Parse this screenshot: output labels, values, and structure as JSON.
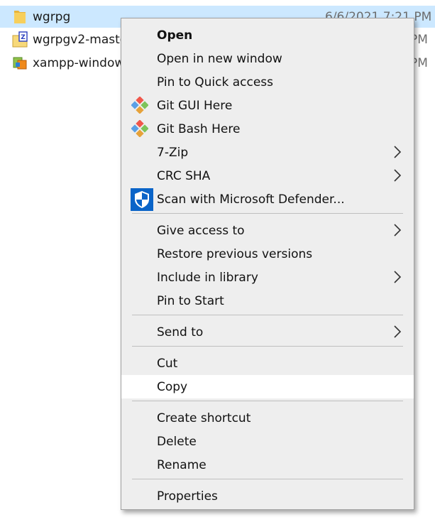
{
  "files": [
    {
      "name": "wgrpg",
      "date": "6/6/2021 7:21 PM",
      "selected": true,
      "icon": "folder-icon"
    },
    {
      "name": "wgrpgv2-maste",
      "date_tail": "PM",
      "icon": "zip-folder-icon"
    },
    {
      "name": "xampp-window",
      "date_tail": "PM",
      "icon": "installer-icon"
    }
  ],
  "menu": {
    "items": [
      {
        "label": "Open",
        "bold": true
      },
      {
        "label": "Open in new window"
      },
      {
        "label": "Pin to Quick access"
      },
      {
        "label": "Git GUI Here",
        "icon": "git-icon"
      },
      {
        "label": "Git Bash Here",
        "icon": "git-icon"
      },
      {
        "label": "7-Zip",
        "submenu": true
      },
      {
        "label": "CRC SHA",
        "submenu": true
      },
      {
        "label": "Scan with Microsoft Defender...",
        "icon": "defender-shield-icon"
      },
      {
        "label": "Give access to",
        "submenu": true
      },
      {
        "label": "Restore previous versions"
      },
      {
        "label": "Include in library",
        "submenu": true
      },
      {
        "label": "Pin to Start"
      },
      {
        "label": "Send to",
        "submenu": true
      },
      {
        "label": "Cut"
      },
      {
        "label": "Copy",
        "hovered": true
      },
      {
        "label": "Create shortcut"
      },
      {
        "label": "Delete"
      },
      {
        "label": "Rename"
      },
      {
        "label": "Properties"
      }
    ]
  },
  "colors": {
    "selection": "#cce8ff",
    "menu_bg": "#eeeeee",
    "hover_bg": "#ffffff",
    "defender_blue": "#0a64c8"
  }
}
